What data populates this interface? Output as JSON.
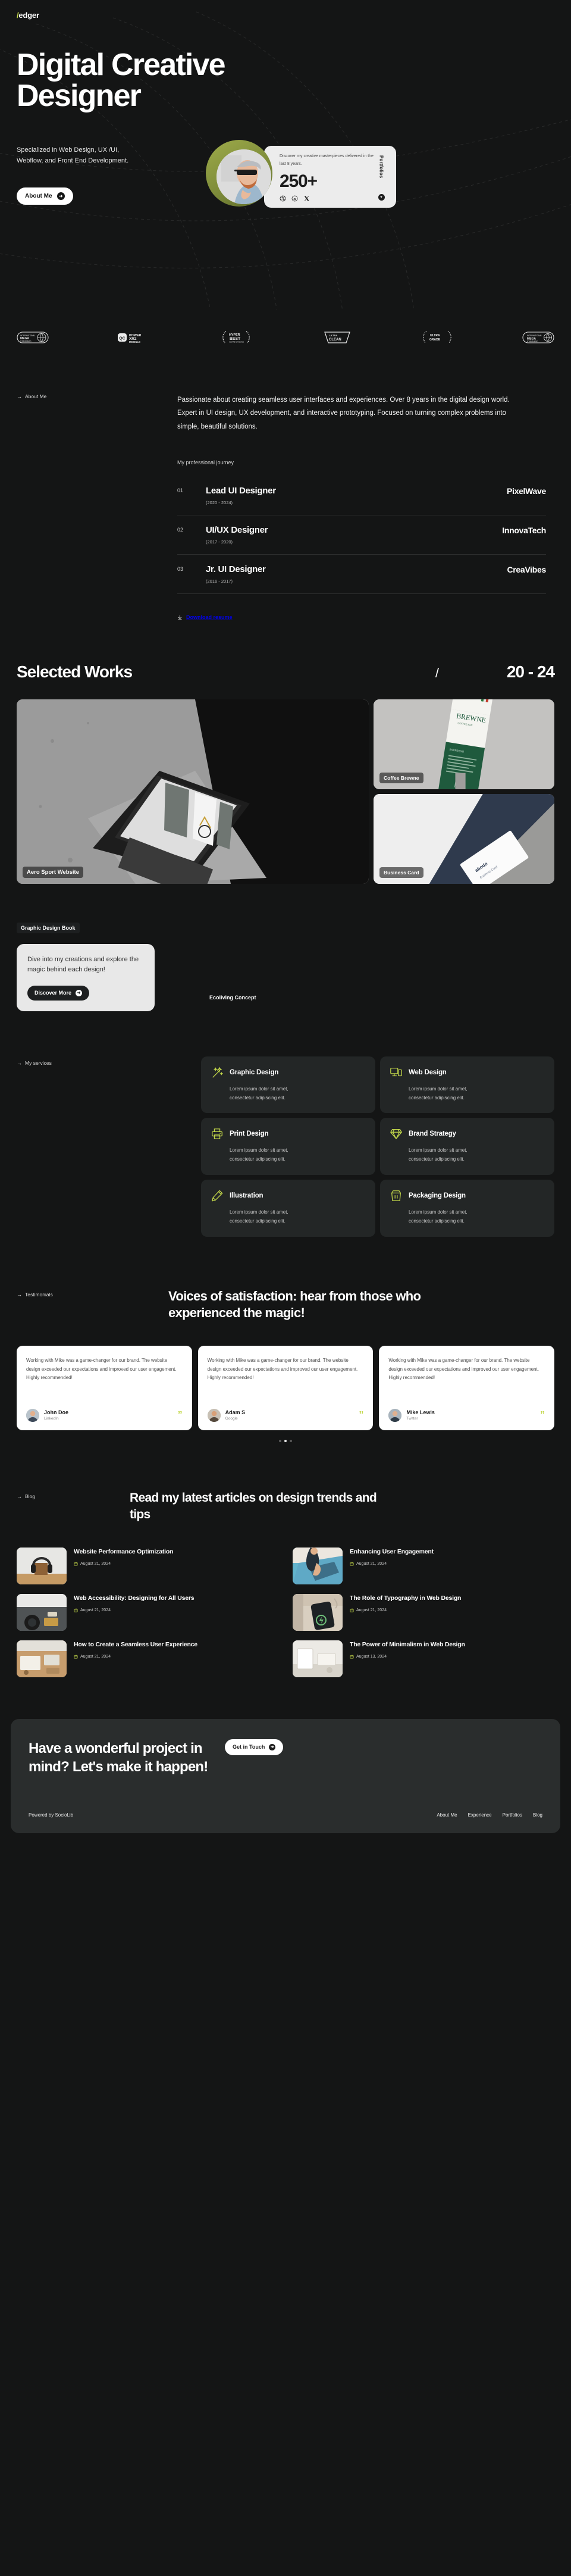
{
  "brand": {
    "slash": "/",
    "name": "edger"
  },
  "hero": {
    "title": "Digital Creative Designer",
    "subtitle": "Specialized in Web Design, UX /UI, Webflow, and Front End Development.",
    "cta_label": "About Me",
    "stat_card": {
      "description": "Discover my creative masterpieces delivered in the last 8 years.",
      "number": "250+",
      "side_label": "Portfolios",
      "socials": [
        "dribbble-icon",
        "threads-icon",
        "x-icon"
      ]
    }
  },
  "logos": [
    {
      "name": "international-mega-standard-logo",
      "line1": "INTERNATIONAL",
      "line2": "MEGA",
      "line3": "STANDARD"
    },
    {
      "name": "power-xr2-module-logo",
      "badge": "QC",
      "line1": "POWER",
      "line2": "XR2",
      "line3": "MODULE"
    },
    {
      "name": "hyper-best-award-logo",
      "line1": "HYPER",
      "line2": "BEST",
      "line3": "AWARD WINNING"
    },
    {
      "name": "ultra-clean-logo",
      "line1": "ULTRA",
      "line2": "CLEAN"
    },
    {
      "name": "ultra-grade-logo",
      "line1": "ULTRA",
      "line2": "GRADE"
    },
    {
      "name": "standard-mark-logo",
      "line1": "STANDARD"
    }
  ],
  "about": {
    "eyebrow": "About Me",
    "body": "Passionate about creating seamless user interfaces and experiences. Over 8 years in the digital design world. Expert in UI design, UX development, and interactive prototyping. Focused on turning complex problems into simple, beautiful solutions.",
    "journey_label": "My professional journey",
    "jobs": [
      {
        "num": "01",
        "title": "Lead UI Designer",
        "years": "(2020 - 2024)",
        "company": "PixelWave"
      },
      {
        "num": "02",
        "title": "UI/UX Designer",
        "years": "(2017 - 2020)",
        "company": "InnovaTech"
      },
      {
        "num": "03",
        "title": "Jr. UI Designer",
        "years": "(2016 - 2017)",
        "company": "CreaVibes"
      }
    ],
    "resume_label": "Download resume"
  },
  "works": {
    "title": "Selected Works",
    "separator": "/",
    "years": "20 - 24",
    "items": [
      {
        "name": "Aero Sport Website",
        "kind": "large"
      },
      {
        "name": "Coffee Brewne",
        "kind": "small"
      },
      {
        "name": "Business Card",
        "kind": "small"
      }
    ]
  },
  "book": {
    "tag": "Graphic Design Book",
    "blurb": "Dive into my creations and explore the magic behind each design!",
    "button": "Discover More",
    "concept_label": "Ecoliving Concept"
  },
  "services": {
    "eyebrow": "My services",
    "items": [
      {
        "name": "Graphic Design",
        "icon": "magic-wand-icon",
        "desc": "Lorem ipsum dolor sit amet, consectetur adipiscing elit."
      },
      {
        "name": "Web Design",
        "icon": "devices-icon",
        "desc": "Lorem ipsum dolor sit amet, consectetur adipiscing elit."
      },
      {
        "name": "Print Design",
        "icon": "printer-icon",
        "desc": "Lorem ipsum dolor sit amet, consectetur adipiscing elit."
      },
      {
        "name": "Brand Strategy",
        "icon": "diamond-icon",
        "desc": "Lorem ipsum dolor sit amet, consectetur adipiscing elit."
      },
      {
        "name": "Illustration",
        "icon": "pen-icon",
        "desc": "Lorem ipsum dolor sit amet, consectetur adipiscing elit."
      },
      {
        "name": "Packaging Design",
        "icon": "box-icon",
        "desc": "Lorem ipsum dolor sit amet, consectetur adipiscing elit."
      }
    ]
  },
  "testimonials": {
    "eyebrow": "Testimonials",
    "heading": "Voices of satisfaction: hear from those who experienced the magic!",
    "cards": [
      {
        "quote": "Working with Mike was a game-changer for our brand. The website design exceeded our expectations and improved our user engagement. Highly recommended!",
        "name": "John Doe",
        "role": "LinkedIn"
      },
      {
        "quote": "Working with Mike was a game-changer for our brand. The website design exceeded our expectations and improved our user engagement. Highly recommended!",
        "name": "Adam S",
        "role": "Google"
      },
      {
        "quote": "Working with Mike was a game-changer for our brand. The website design exceeded our expectations and improved our user engagement. Highly recommended!",
        "name": "Mike Lewis",
        "role": "Twitter"
      }
    ],
    "active_dot": 1,
    "dot_count": 3
  },
  "blog": {
    "eyebrow": "Blog",
    "heading": "Read my latest articles on design trends and tips",
    "posts": [
      {
        "title": "Website Performance Optimization",
        "date": "August 21, 2024"
      },
      {
        "title": "Enhancing User Engagement",
        "date": "August 21, 2024"
      },
      {
        "title": "Web Accessibility: Designing for All Users",
        "date": "August 21, 2024"
      },
      {
        "title": "The Role of Typography in Web Design",
        "date": "August 21, 2024"
      },
      {
        "title": "How to Create a Seamless User Experience",
        "date": "August 21, 2024"
      },
      {
        "title": "The Power of Minimalism in Web Design",
        "date": "August 13, 2024"
      }
    ]
  },
  "cta": {
    "title": "Have a wonderful project in mind? Let's make it happen!",
    "button": "Get in Touch",
    "powered_by": "Powered by SocioLib",
    "nav": [
      "About Me",
      "Experience",
      "Portfolios",
      "Blog"
    ]
  },
  "colors": {
    "background": "#141515",
    "accent": "#c3d84a",
    "card_dark": "#232626",
    "card_light": "#e8e8e8",
    "cta_panel": "#2a2d2d"
  }
}
